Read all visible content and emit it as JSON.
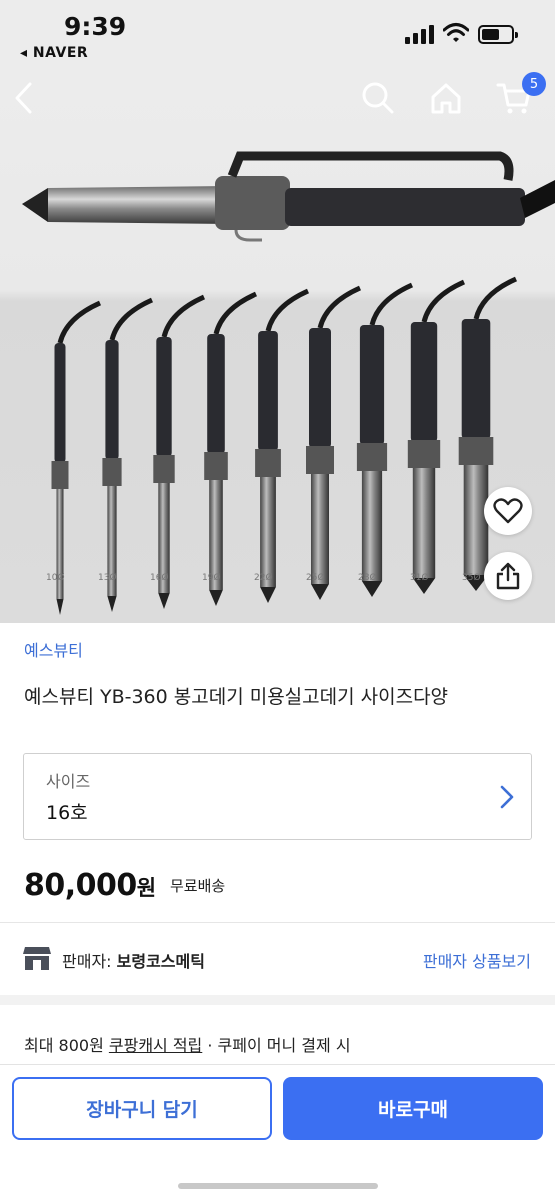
{
  "status_bar": {
    "time": "9:39",
    "back_app": "◂ NAVER"
  },
  "product_image": {
    "size_labels": [
      "10Ø",
      "13Ø",
      "16Ø",
      "19Ø",
      "22Ø",
      "25Ø",
      "28Ø",
      "31Ø",
      "35Ø"
    ]
  },
  "cart_badge": "5",
  "product": {
    "brand": "예스뷰티",
    "title": "예스뷰티 YB-360 봉고데기 미용실고데기 사이즈다양",
    "option_label": "사이즈",
    "option_value": "16호",
    "price": "80,000",
    "price_unit": "원",
    "shipping": "무료배송"
  },
  "seller": {
    "label": "판매자: ",
    "name": "보령코스메틱",
    "link": "판매자 상품보기"
  },
  "cashback": {
    "prefix": "최대 800원 ",
    "link": "쿠팡캐시 적립",
    "suffix": " · 쿠페이 머니 결제 시"
  },
  "bottom": {
    "cart_button": "장바구니 담기",
    "buy_button": "바로구매"
  },
  "colors": {
    "accent": "#3b6ff2",
    "brand_text": "#3d6fd6"
  },
  "icons": [
    "back-arrow-icon",
    "search-icon",
    "home-icon",
    "cart-icon",
    "heart-icon",
    "share-icon",
    "store-icon",
    "chevron-right-icon"
  ]
}
